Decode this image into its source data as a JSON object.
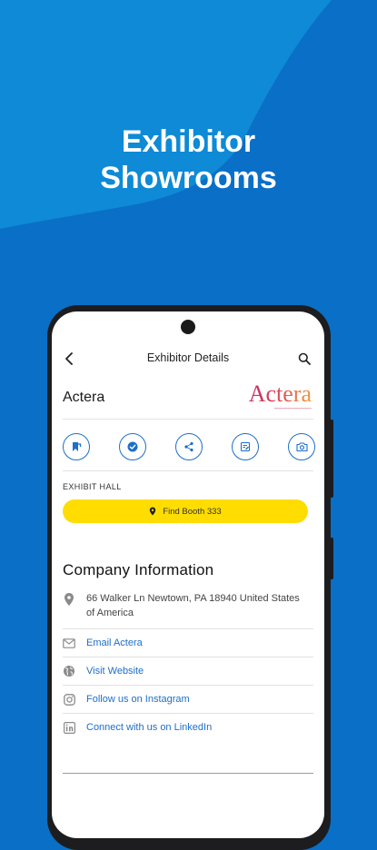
{
  "promo": {
    "title_line1": "Exhibitor",
    "title_line2": "Showrooms"
  },
  "appbar": {
    "title": "Exhibitor Details"
  },
  "exhibitor": {
    "name": "Actera",
    "logo_text": "Actera"
  },
  "actions": [
    {
      "icon": "bookmark-icon"
    },
    {
      "icon": "check-circle-icon"
    },
    {
      "icon": "share-icon"
    },
    {
      "icon": "note-icon"
    },
    {
      "icon": "camera-icon"
    }
  ],
  "exhibit_hall": {
    "label": "EXHIBIT HALL",
    "find_booth_label": "Find Booth 333"
  },
  "company_info": {
    "heading": "Company Information",
    "address": "66 Walker Ln Newtown, PA 18940 United States of America",
    "links": [
      {
        "icon": "email-icon",
        "label": "Email Actera"
      },
      {
        "icon": "globe-icon",
        "label": "Visit Website"
      },
      {
        "icon": "instagram-icon",
        "label": "Follow us on Instagram"
      },
      {
        "icon": "linkedin-icon",
        "label": "Connect with us on LinkedIn"
      }
    ]
  },
  "colors": {
    "background": "#0a6fc6",
    "accent": "#1d6fc9",
    "booth_button": "#ffdd00"
  }
}
